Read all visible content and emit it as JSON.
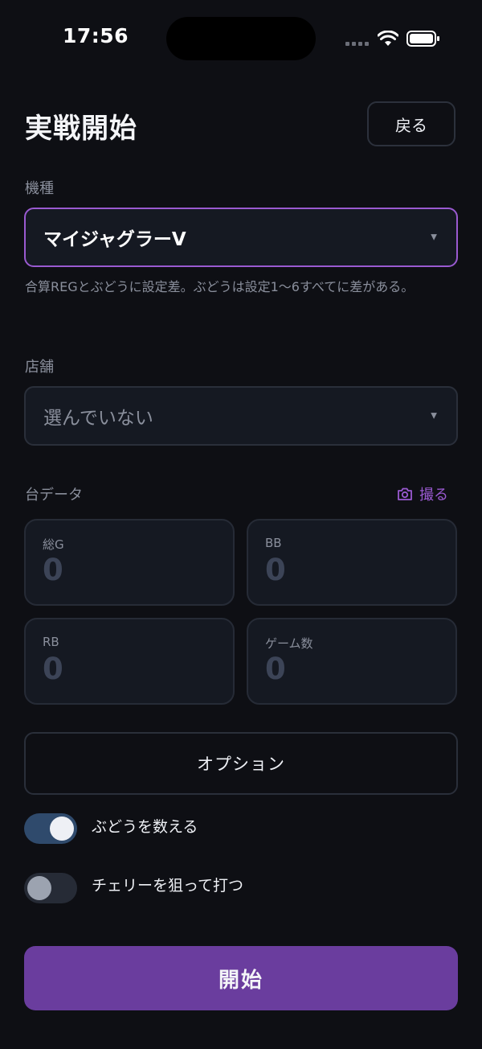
{
  "status": {
    "time": "17:56"
  },
  "header": {
    "title": "実戦開始",
    "back_label": "戻る"
  },
  "machine": {
    "label": "機種",
    "selected": "マイジャグラーV",
    "hint": "合算REGとぶどうに設定差。ぶどうは設定1〜6すべてに差がある。"
  },
  "store": {
    "label": "店舗",
    "selected": "選んでいない"
  },
  "stats": {
    "label": "台データ",
    "capture_label": "撮る",
    "fields": [
      {
        "label": "総G",
        "value": "0"
      },
      {
        "label": "BB",
        "value": "0"
      },
      {
        "label": "RB",
        "value": "0"
      },
      {
        "label": "ゲーム数",
        "value": "0"
      }
    ]
  },
  "options": {
    "button_label": "オプション"
  },
  "toggles": [
    {
      "label": "ぶどうを数える",
      "on": true
    },
    {
      "label": "チェリーを狙って打つ",
      "on": false
    }
  ],
  "start": {
    "label": "開始"
  },
  "colors": {
    "accent": "#9a5ad1",
    "start_button": "#6a3d9e",
    "background": "#0e0f14"
  }
}
